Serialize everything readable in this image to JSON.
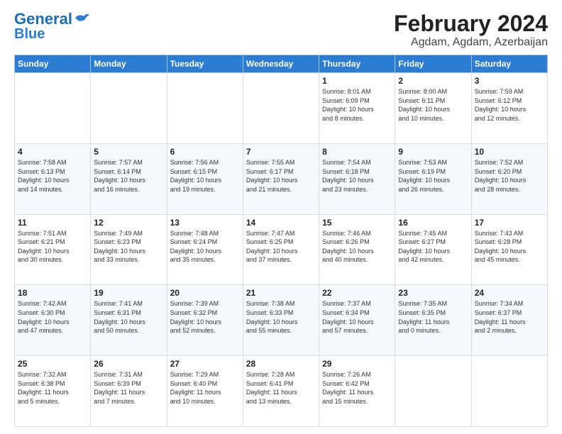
{
  "logo": {
    "line1": "General",
    "line2": "Blue"
  },
  "title": "February 2024",
  "subtitle": "Agdam, Agdam, Azerbaijan",
  "weekdays": [
    "Sunday",
    "Monday",
    "Tuesday",
    "Wednesday",
    "Thursday",
    "Friday",
    "Saturday"
  ],
  "weeks": [
    [
      {
        "day": "",
        "info": ""
      },
      {
        "day": "",
        "info": ""
      },
      {
        "day": "",
        "info": ""
      },
      {
        "day": "",
        "info": ""
      },
      {
        "day": "1",
        "info": "Sunrise: 8:01 AM\nSunset: 6:09 PM\nDaylight: 10 hours\nand 8 minutes."
      },
      {
        "day": "2",
        "info": "Sunrise: 8:00 AM\nSunset: 6:11 PM\nDaylight: 10 hours\nand 10 minutes."
      },
      {
        "day": "3",
        "info": "Sunrise: 7:59 AM\nSunset: 6:12 PM\nDaylight: 10 hours\nand 12 minutes."
      }
    ],
    [
      {
        "day": "4",
        "info": "Sunrise: 7:58 AM\nSunset: 6:13 PM\nDaylight: 10 hours\nand 14 minutes."
      },
      {
        "day": "5",
        "info": "Sunrise: 7:57 AM\nSunset: 6:14 PM\nDaylight: 10 hours\nand 16 minutes."
      },
      {
        "day": "6",
        "info": "Sunrise: 7:56 AM\nSunset: 6:15 PM\nDaylight: 10 hours\nand 19 minutes."
      },
      {
        "day": "7",
        "info": "Sunrise: 7:55 AM\nSunset: 6:17 PM\nDaylight: 10 hours\nand 21 minutes."
      },
      {
        "day": "8",
        "info": "Sunrise: 7:54 AM\nSunset: 6:18 PM\nDaylight: 10 hours\nand 23 minutes."
      },
      {
        "day": "9",
        "info": "Sunrise: 7:53 AM\nSunset: 6:19 PM\nDaylight: 10 hours\nand 26 minutes."
      },
      {
        "day": "10",
        "info": "Sunrise: 7:52 AM\nSunset: 6:20 PM\nDaylight: 10 hours\nand 28 minutes."
      }
    ],
    [
      {
        "day": "11",
        "info": "Sunrise: 7:51 AM\nSunset: 6:21 PM\nDaylight: 10 hours\nand 30 minutes."
      },
      {
        "day": "12",
        "info": "Sunrise: 7:49 AM\nSunset: 6:23 PM\nDaylight: 10 hours\nand 33 minutes."
      },
      {
        "day": "13",
        "info": "Sunrise: 7:48 AM\nSunset: 6:24 PM\nDaylight: 10 hours\nand 35 minutes."
      },
      {
        "day": "14",
        "info": "Sunrise: 7:47 AM\nSunset: 6:25 PM\nDaylight: 10 hours\nand 37 minutes."
      },
      {
        "day": "15",
        "info": "Sunrise: 7:46 AM\nSunset: 6:26 PM\nDaylight: 10 hours\nand 40 minutes."
      },
      {
        "day": "16",
        "info": "Sunrise: 7:45 AM\nSunset: 6:27 PM\nDaylight: 10 hours\nand 42 minutes."
      },
      {
        "day": "17",
        "info": "Sunrise: 7:43 AM\nSunset: 6:28 PM\nDaylight: 10 hours\nand 45 minutes."
      }
    ],
    [
      {
        "day": "18",
        "info": "Sunrise: 7:42 AM\nSunset: 6:30 PM\nDaylight: 10 hours\nand 47 minutes."
      },
      {
        "day": "19",
        "info": "Sunrise: 7:41 AM\nSunset: 6:31 PM\nDaylight: 10 hours\nand 50 minutes."
      },
      {
        "day": "20",
        "info": "Sunrise: 7:39 AM\nSunset: 6:32 PM\nDaylight: 10 hours\nand 52 minutes."
      },
      {
        "day": "21",
        "info": "Sunrise: 7:38 AM\nSunset: 6:33 PM\nDaylight: 10 hours\nand 55 minutes."
      },
      {
        "day": "22",
        "info": "Sunrise: 7:37 AM\nSunset: 6:34 PM\nDaylight: 10 hours\nand 57 minutes."
      },
      {
        "day": "23",
        "info": "Sunrise: 7:35 AM\nSunset: 6:35 PM\nDaylight: 11 hours\nand 0 minutes."
      },
      {
        "day": "24",
        "info": "Sunrise: 7:34 AM\nSunset: 6:37 PM\nDaylight: 11 hours\nand 2 minutes."
      }
    ],
    [
      {
        "day": "25",
        "info": "Sunrise: 7:32 AM\nSunset: 6:38 PM\nDaylight: 11 hours\nand 5 minutes."
      },
      {
        "day": "26",
        "info": "Sunrise: 7:31 AM\nSunset: 6:39 PM\nDaylight: 11 hours\nand 7 minutes."
      },
      {
        "day": "27",
        "info": "Sunrise: 7:29 AM\nSunset: 6:40 PM\nDaylight: 11 hours\nand 10 minutes."
      },
      {
        "day": "28",
        "info": "Sunrise: 7:28 AM\nSunset: 6:41 PM\nDaylight: 11 hours\nand 13 minutes."
      },
      {
        "day": "29",
        "info": "Sunrise: 7:26 AM\nSunset: 6:42 PM\nDaylight: 11 hours\nand 15 minutes."
      },
      {
        "day": "",
        "info": ""
      },
      {
        "day": "",
        "info": ""
      }
    ]
  ]
}
